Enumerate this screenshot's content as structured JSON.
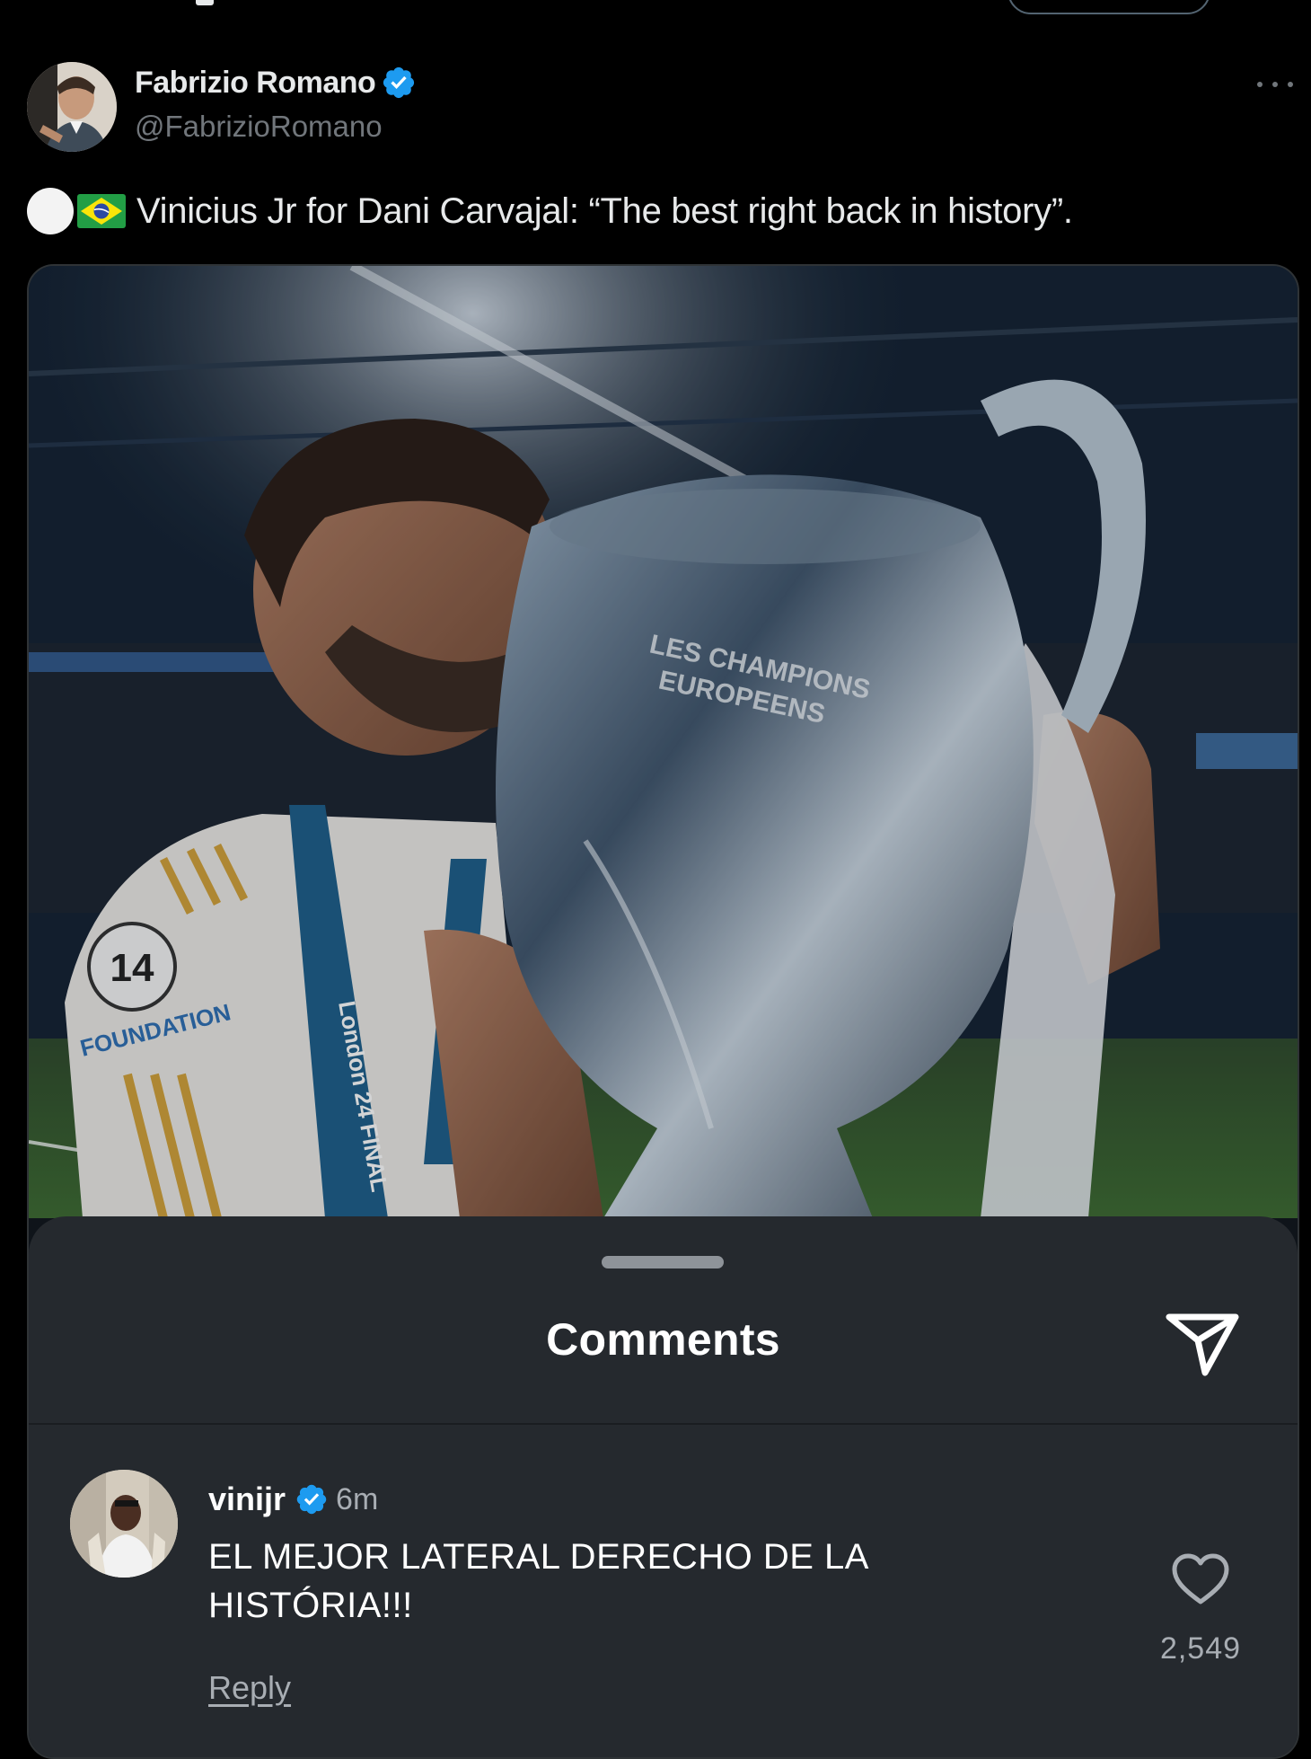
{
  "author": {
    "name": "Fabrizio Romano",
    "handle": "@FabrizioRomano",
    "verified_color": "#1d9bf0"
  },
  "post": {
    "emoji_prefix": [
      "white-circle",
      "brazil-flag"
    ],
    "text": "Vinicius Jr for Dani Carvajal: “The best right back in history”."
  },
  "media": {
    "trophy_engraving": [
      "LES CHAMPIONS",
      "EUROPEENS"
    ],
    "badge_number": "14",
    "sleeve_text": "FOUNDATION",
    "lanyard_text": "London 24 FINAL"
  },
  "comments_sheet": {
    "title": "Comments",
    "comment": {
      "user": "vinijr",
      "time": "6m",
      "body": "EL MEJOR LATERAL DERECHO DE LA HISTÓRIA!!!",
      "reply_label": "Reply",
      "like_count": "2,549"
    }
  },
  "colors": {
    "background": "#000000",
    "sheet": "#25292e",
    "verified": "#1d9bf0"
  }
}
